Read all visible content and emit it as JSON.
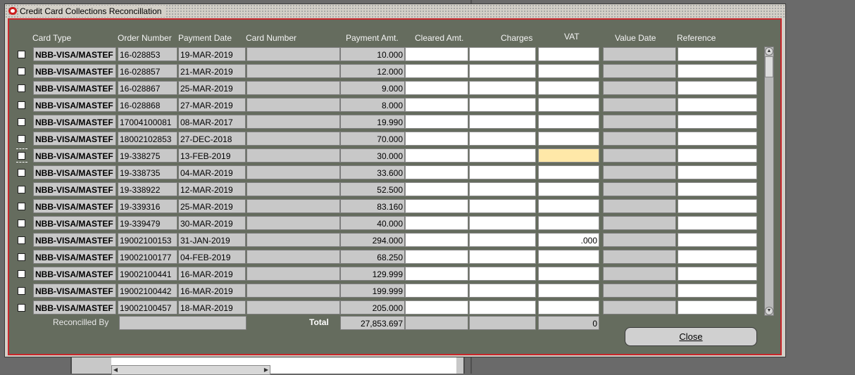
{
  "window": {
    "title": "Credit Card Collections Reconcillation"
  },
  "columns": {
    "card_type": "Card Type",
    "order_number": "Order Number",
    "payment_date": "Payment Date",
    "card_number": "Card Number",
    "payment_amt": "Payment Amt.",
    "cleared_amt": "Cleared Amt.",
    "charges": "Charges",
    "vat": "VAT",
    "value_date": "Value Date",
    "reference": "Reference"
  },
  "rows": [
    {
      "card_type": "NBB-VISA/MASTEF",
      "order_number": "16-028853",
      "payment_date": "19-MAR-2019",
      "card_number": "",
      "payment_amt": "10.000",
      "cleared_amt": "",
      "charges": "",
      "vat": "",
      "value_date": "",
      "reference": ""
    },
    {
      "card_type": "NBB-VISA/MASTEF",
      "order_number": "16-028857",
      "payment_date": "21-MAR-2019",
      "card_number": "",
      "payment_amt": "12.000",
      "cleared_amt": "",
      "charges": "",
      "vat": "",
      "value_date": "",
      "reference": ""
    },
    {
      "card_type": "NBB-VISA/MASTEF",
      "order_number": "16-028867",
      "payment_date": "25-MAR-2019",
      "card_number": "",
      "payment_amt": "9.000",
      "cleared_amt": "",
      "charges": "",
      "vat": "",
      "value_date": "",
      "reference": ""
    },
    {
      "card_type": "NBB-VISA/MASTEF",
      "order_number": "16-028868",
      "payment_date": "27-MAR-2019",
      "card_number": "",
      "payment_amt": "8.000",
      "cleared_amt": "",
      "charges": "",
      "vat": "",
      "value_date": "",
      "reference": ""
    },
    {
      "card_type": "NBB-VISA/MASTEF",
      "order_number": "17004100081",
      "payment_date": "08-MAR-2017",
      "card_number": "",
      "payment_amt": "19.990",
      "cleared_amt": "",
      "charges": "",
      "vat": "",
      "value_date": "",
      "reference": ""
    },
    {
      "card_type": "NBB-VISA/MASTEF",
      "order_number": "18002102853",
      "payment_date": "27-DEC-2018",
      "card_number": "",
      "payment_amt": "70.000",
      "cleared_amt": "",
      "charges": "",
      "vat": "",
      "value_date": "",
      "reference": ""
    },
    {
      "card_type": "NBB-VISA/MASTEF",
      "order_number": "19-338275",
      "payment_date": "13-FEB-2019",
      "card_number": "",
      "payment_amt": "30.000",
      "cleared_amt": "",
      "charges": "",
      "vat": "",
      "value_date": "",
      "reference": "",
      "current": true
    },
    {
      "card_type": "NBB-VISA/MASTEF",
      "order_number": "19-338735",
      "payment_date": "04-MAR-2019",
      "card_number": "",
      "payment_amt": "33.600",
      "cleared_amt": "",
      "charges": "",
      "vat": "",
      "value_date": "",
      "reference": ""
    },
    {
      "card_type": "NBB-VISA/MASTEF",
      "order_number": "19-338922",
      "payment_date": "12-MAR-2019",
      "card_number": "",
      "payment_amt": "52.500",
      "cleared_amt": "",
      "charges": "",
      "vat": "",
      "value_date": "",
      "reference": ""
    },
    {
      "card_type": "NBB-VISA/MASTEF",
      "order_number": "19-339316",
      "payment_date": "25-MAR-2019",
      "card_number": "",
      "payment_amt": "83.160",
      "cleared_amt": "",
      "charges": "",
      "vat": "",
      "value_date": "",
      "reference": ""
    },
    {
      "card_type": "NBB-VISA/MASTEF",
      "order_number": "19-339479",
      "payment_date": "30-MAR-2019",
      "card_number": "",
      "payment_amt": "40.000",
      "cleared_amt": "",
      "charges": "",
      "vat": "",
      "value_date": "",
      "reference": ""
    },
    {
      "card_type": "NBB-VISA/MASTEF",
      "order_number": "19002100153",
      "payment_date": "31-JAN-2019",
      "card_number": "",
      "payment_amt": "294.000",
      "cleared_amt": "",
      "charges": "",
      "vat": ".000",
      "value_date": "",
      "reference": ""
    },
    {
      "card_type": "NBB-VISA/MASTEF",
      "order_number": "19002100177",
      "payment_date": "04-FEB-2019",
      "card_number": "",
      "payment_amt": "68.250",
      "cleared_amt": "",
      "charges": "",
      "vat": "",
      "value_date": "",
      "reference": ""
    },
    {
      "card_type": "NBB-VISA/MASTEF",
      "order_number": "19002100441",
      "payment_date": "16-MAR-2019",
      "card_number": "",
      "payment_amt": "129.999",
      "cleared_amt": "",
      "charges": "",
      "vat": "",
      "value_date": "",
      "reference": ""
    },
    {
      "card_type": "NBB-VISA/MASTEF",
      "order_number": "19002100442",
      "payment_date": "16-MAR-2019",
      "card_number": "",
      "payment_amt": "199.999",
      "cleared_amt": "",
      "charges": "",
      "vat": "",
      "value_date": "",
      "reference": ""
    },
    {
      "card_type": "NBB-VISA/MASTEF",
      "order_number": "19002100457",
      "payment_date": "18-MAR-2019",
      "card_number": "",
      "payment_amt": "205.000",
      "cleared_amt": "",
      "charges": "",
      "vat": "",
      "value_date": "",
      "reference": ""
    }
  ],
  "footer": {
    "reconciled_by_label": "Reconcilled By",
    "reconciled_by_value": "",
    "total_label": "Total",
    "total_payment_amt": "27,853.697",
    "total_cleared_amt": "",
    "total_charges": "",
    "total_vat": "0"
  },
  "buttons": {
    "close_label": "Close"
  },
  "colors": {
    "panel_bg": "#656c5e",
    "panel_border": "#c8262b",
    "readonly_cell": "#c8c8c8",
    "current_cell": "#ffe8a8"
  }
}
